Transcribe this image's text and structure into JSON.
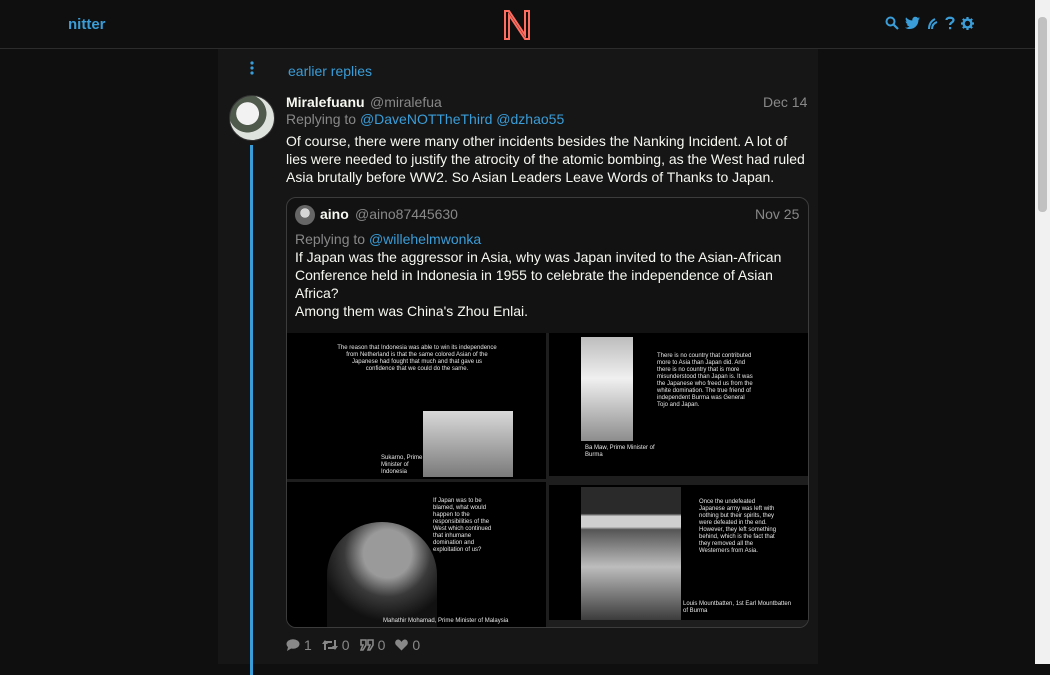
{
  "nav": {
    "brand": "nitter",
    "icons": [
      "search-icon",
      "bird-icon",
      "rss-icon",
      "help-icon",
      "settings-icon"
    ],
    "accent": "#3a9dd8",
    "logo_color": "#ff6c60"
  },
  "thread": {
    "earlier_label": "earlier replies"
  },
  "tweet": {
    "fullname": "Miralefuanu",
    "username": "@miralefua",
    "date": "Dec 14",
    "replying_prefix": "Replying to",
    "replying_to": [
      "@DaveNOTTheThird",
      "@dzhao55"
    ],
    "text": "Of course, there were many other incidents besides the Nanking Incident. A lot of lies were needed to justify the atrocity of the atomic bombing, as the West had ruled Asia brutally before WW2. So Asian Leaders Leave Words of Thanks to Japan.",
    "stats": {
      "replies": "1",
      "retweets": "0",
      "quotes": "0",
      "likes": "0"
    }
  },
  "quote": {
    "fullname": "aino",
    "username": "@aino87445630",
    "date": "Nov 25",
    "replying_prefix": "Replying to",
    "replying_to": "@willehelmwonka",
    "text_lines": [
      "If Japan was the aggressor in Asia, why was Japan invited to the Asian-African Conference held in Indonesia in 1955 to celebrate the independence of Asian Africa?",
      "Among them was China's Zhou Enlai."
    ],
    "images": [
      {
        "caption": "The reason that Indonesia was able to win its independence from Netherland is that the same colored Asian of the Japanese had fought that much and that gave us confidence that we could do the same.",
        "credit": "Sukarno, Prime Minister of Indonesia"
      },
      {
        "caption": "There is no country that contributed more to Asia than Japan did. And there is no country that is more misunderstood than Japan is. It was the Japanese who freed us from the white domination. The true friend of independent Burma was General Tojo and Japan.",
        "credit": "Ba Maw, Prime Minister of Burma"
      },
      {
        "caption": "If Japan was to be blamed, what would happen to the responsibilities of the West which continued that inhumane domination and exploitation of us?",
        "credit": "Mahathir Mohamad, Prime Minister of Malaysia"
      },
      {
        "caption": "Once the undefeated Japanese army was left with nothing but their spirits, they were defeated in the end. However, they left something behind, which is the fact that they removed all the Westerners from Asia.",
        "credit": "Louis Mountbatten, 1st Earl Mountbatten of Burma"
      }
    ]
  }
}
